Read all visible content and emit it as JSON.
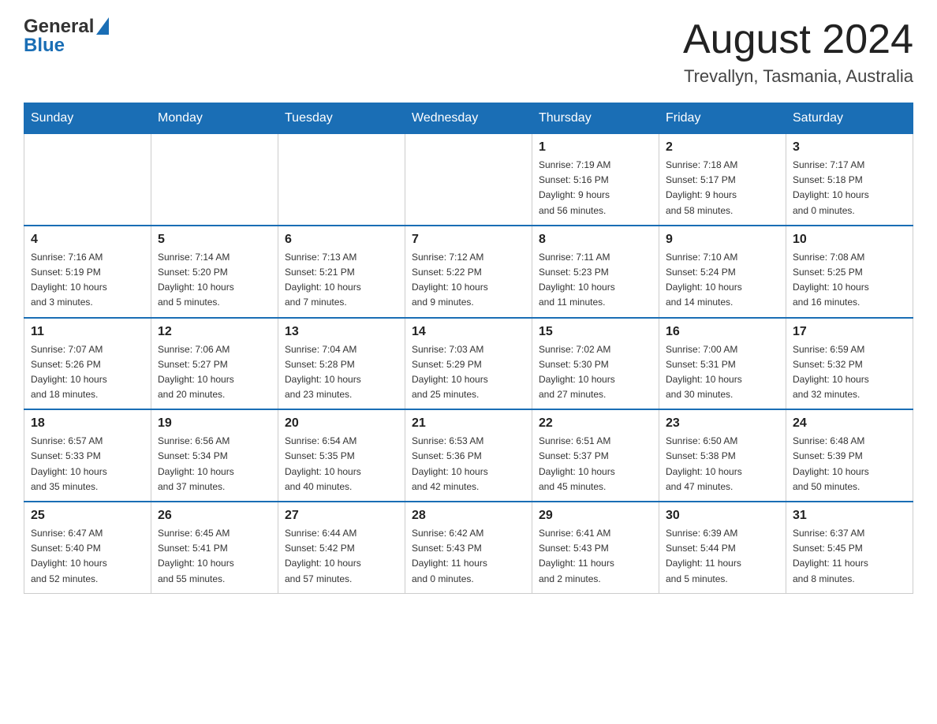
{
  "header": {
    "logo_general": "General",
    "logo_blue": "Blue",
    "month_title": "August 2024",
    "location": "Trevallyn, Tasmania, Australia"
  },
  "calendar": {
    "days_of_week": [
      "Sunday",
      "Monday",
      "Tuesday",
      "Wednesday",
      "Thursday",
      "Friday",
      "Saturday"
    ],
    "weeks": [
      {
        "cells": [
          {
            "day": "",
            "info": ""
          },
          {
            "day": "",
            "info": ""
          },
          {
            "day": "",
            "info": ""
          },
          {
            "day": "",
            "info": ""
          },
          {
            "day": "1",
            "info": "Sunrise: 7:19 AM\nSunset: 5:16 PM\nDaylight: 9 hours\nand 56 minutes."
          },
          {
            "day": "2",
            "info": "Sunrise: 7:18 AM\nSunset: 5:17 PM\nDaylight: 9 hours\nand 58 minutes."
          },
          {
            "day": "3",
            "info": "Sunrise: 7:17 AM\nSunset: 5:18 PM\nDaylight: 10 hours\nand 0 minutes."
          }
        ]
      },
      {
        "cells": [
          {
            "day": "4",
            "info": "Sunrise: 7:16 AM\nSunset: 5:19 PM\nDaylight: 10 hours\nand 3 minutes."
          },
          {
            "day": "5",
            "info": "Sunrise: 7:14 AM\nSunset: 5:20 PM\nDaylight: 10 hours\nand 5 minutes."
          },
          {
            "day": "6",
            "info": "Sunrise: 7:13 AM\nSunset: 5:21 PM\nDaylight: 10 hours\nand 7 minutes."
          },
          {
            "day": "7",
            "info": "Sunrise: 7:12 AM\nSunset: 5:22 PM\nDaylight: 10 hours\nand 9 minutes."
          },
          {
            "day": "8",
            "info": "Sunrise: 7:11 AM\nSunset: 5:23 PM\nDaylight: 10 hours\nand 11 minutes."
          },
          {
            "day": "9",
            "info": "Sunrise: 7:10 AM\nSunset: 5:24 PM\nDaylight: 10 hours\nand 14 minutes."
          },
          {
            "day": "10",
            "info": "Sunrise: 7:08 AM\nSunset: 5:25 PM\nDaylight: 10 hours\nand 16 minutes."
          }
        ]
      },
      {
        "cells": [
          {
            "day": "11",
            "info": "Sunrise: 7:07 AM\nSunset: 5:26 PM\nDaylight: 10 hours\nand 18 minutes."
          },
          {
            "day": "12",
            "info": "Sunrise: 7:06 AM\nSunset: 5:27 PM\nDaylight: 10 hours\nand 20 minutes."
          },
          {
            "day": "13",
            "info": "Sunrise: 7:04 AM\nSunset: 5:28 PM\nDaylight: 10 hours\nand 23 minutes."
          },
          {
            "day": "14",
            "info": "Sunrise: 7:03 AM\nSunset: 5:29 PM\nDaylight: 10 hours\nand 25 minutes."
          },
          {
            "day": "15",
            "info": "Sunrise: 7:02 AM\nSunset: 5:30 PM\nDaylight: 10 hours\nand 27 minutes."
          },
          {
            "day": "16",
            "info": "Sunrise: 7:00 AM\nSunset: 5:31 PM\nDaylight: 10 hours\nand 30 minutes."
          },
          {
            "day": "17",
            "info": "Sunrise: 6:59 AM\nSunset: 5:32 PM\nDaylight: 10 hours\nand 32 minutes."
          }
        ]
      },
      {
        "cells": [
          {
            "day": "18",
            "info": "Sunrise: 6:57 AM\nSunset: 5:33 PM\nDaylight: 10 hours\nand 35 minutes."
          },
          {
            "day": "19",
            "info": "Sunrise: 6:56 AM\nSunset: 5:34 PM\nDaylight: 10 hours\nand 37 minutes."
          },
          {
            "day": "20",
            "info": "Sunrise: 6:54 AM\nSunset: 5:35 PM\nDaylight: 10 hours\nand 40 minutes."
          },
          {
            "day": "21",
            "info": "Sunrise: 6:53 AM\nSunset: 5:36 PM\nDaylight: 10 hours\nand 42 minutes."
          },
          {
            "day": "22",
            "info": "Sunrise: 6:51 AM\nSunset: 5:37 PM\nDaylight: 10 hours\nand 45 minutes."
          },
          {
            "day": "23",
            "info": "Sunrise: 6:50 AM\nSunset: 5:38 PM\nDaylight: 10 hours\nand 47 minutes."
          },
          {
            "day": "24",
            "info": "Sunrise: 6:48 AM\nSunset: 5:39 PM\nDaylight: 10 hours\nand 50 minutes."
          }
        ]
      },
      {
        "cells": [
          {
            "day": "25",
            "info": "Sunrise: 6:47 AM\nSunset: 5:40 PM\nDaylight: 10 hours\nand 52 minutes."
          },
          {
            "day": "26",
            "info": "Sunrise: 6:45 AM\nSunset: 5:41 PM\nDaylight: 10 hours\nand 55 minutes."
          },
          {
            "day": "27",
            "info": "Sunrise: 6:44 AM\nSunset: 5:42 PM\nDaylight: 10 hours\nand 57 minutes."
          },
          {
            "day": "28",
            "info": "Sunrise: 6:42 AM\nSunset: 5:43 PM\nDaylight: 11 hours\nand 0 minutes."
          },
          {
            "day": "29",
            "info": "Sunrise: 6:41 AM\nSunset: 5:43 PM\nDaylight: 11 hours\nand 2 minutes."
          },
          {
            "day": "30",
            "info": "Sunrise: 6:39 AM\nSunset: 5:44 PM\nDaylight: 11 hours\nand 5 minutes."
          },
          {
            "day": "31",
            "info": "Sunrise: 6:37 AM\nSunset: 5:45 PM\nDaylight: 11 hours\nand 8 minutes."
          }
        ]
      }
    ]
  }
}
